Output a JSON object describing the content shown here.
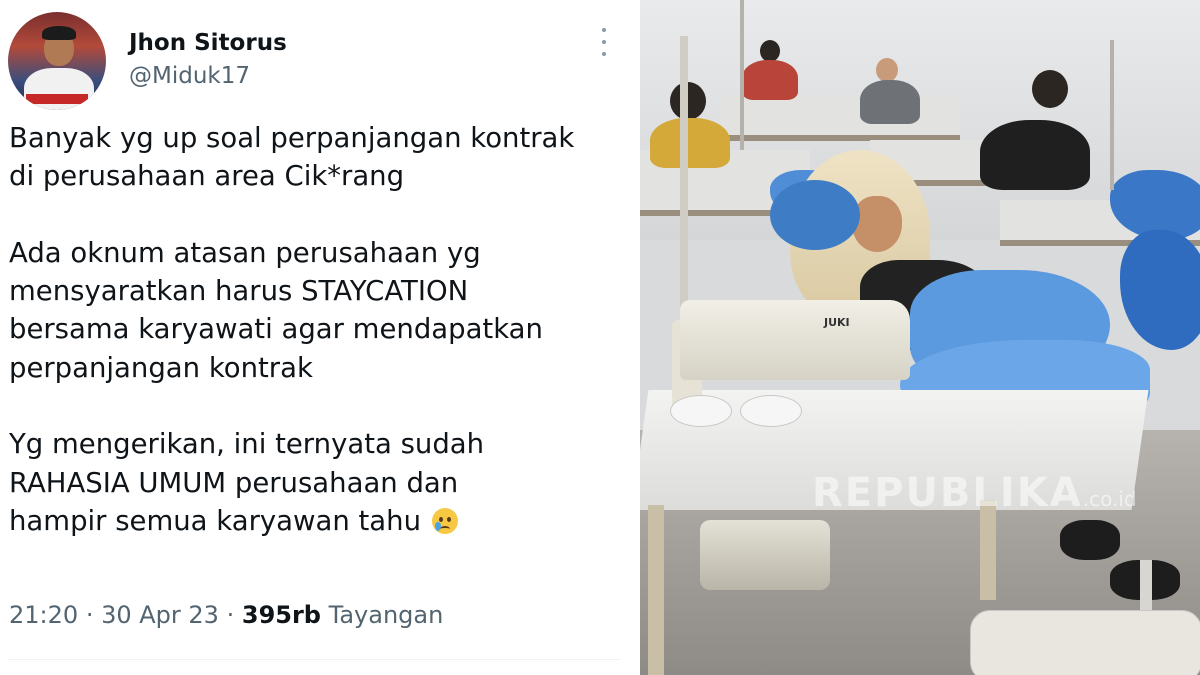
{
  "tweet": {
    "display_name": "Jhon Sitorus",
    "handle": "@Miduk17",
    "avatar_icon": "profile-photo",
    "more_icon": "three-dots-vertical",
    "paragraphs": [
      [
        "Banyak yg up soal perpanjangan kontrak",
        "di perusahaan area Cik*rang"
      ],
      [
        "Ada oknum atasan perusahaan yg",
        "mensyaratkan harus STAYCATION",
        "bersama karyawati agar mendapatkan",
        "perpanjangan kontrak"
      ],
      [
        "Yg mengerikan, ini ternyata sudah",
        "RAHASIA UMUM perusahaan dan",
        "hampir semua karyawan tahu"
      ]
    ],
    "emoji": "crying-face",
    "time": "21:20",
    "date": "30 Apr 23",
    "separator": "·",
    "views": "395rb",
    "views_label": "Tayangan"
  },
  "photo": {
    "machine_brand": "JUKI",
    "watermark": "REPUBLIKA",
    "watermark_suffix": ".co.id"
  },
  "colors": {
    "text_primary": "#0f1419",
    "text_secondary": "#536471",
    "cloth_blue": "#5c9ae0"
  }
}
